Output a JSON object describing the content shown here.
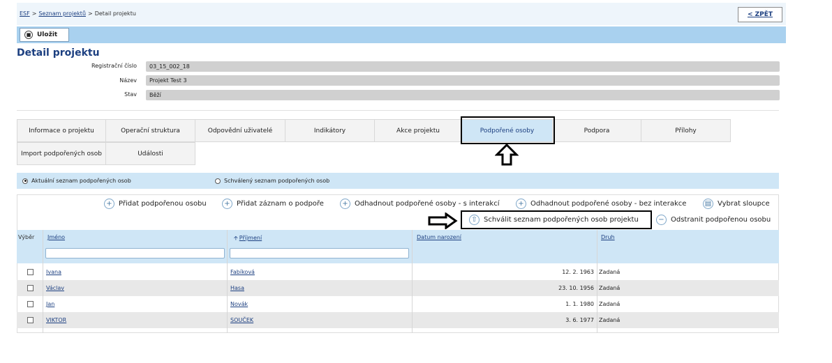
{
  "breadcrumb": [
    "ESF",
    "Seznam projektů",
    "Detail projektu"
  ],
  "back_label": "< ZPĚT",
  "save_label": "Uložit",
  "page_title": "Detail projektu",
  "fields": [
    {
      "label": "Registrační číslo",
      "value": "03_15_002_18"
    },
    {
      "label": "Název",
      "value": "Projekt Test 3"
    },
    {
      "label": "Stav",
      "value": "Běží"
    }
  ],
  "tabs": [
    "Informace o projektu",
    "Operační struktura",
    "Odpovědní uživatelé",
    "Indikátory",
    "Akce projektu",
    "Podpořené osoby",
    "Podpora",
    "Přílohy",
    "Import podpořených osob",
    "Události"
  ],
  "active_tab": "Podpořené osoby",
  "radios": [
    {
      "label": "Aktuální seznam podpořených osob",
      "checked": true
    },
    {
      "label": "Schválený seznam podpořených osob",
      "checked": false
    }
  ],
  "actions": [
    "Přidat podpořenou osobu",
    "Přidat záznam o podpoře",
    "Odhadnout podpořené osoby - s interakcí",
    "Odhadnout podpořené osoby - bez interakce",
    "Vybrat sloupce",
    "Schválit seznam podpořených osob projektu",
    "Odstranit podpořenou osobu"
  ],
  "columns": {
    "select": "Výběr",
    "first": "Jméno",
    "last": "Příjmení",
    "dob": "Datum narození",
    "kind": "Druh"
  },
  "rows": [
    {
      "first": "Ivana",
      "last": "Fabíková",
      "dob": "12. 2. 1963",
      "kind": "Zadaná"
    },
    {
      "first": "Václav",
      "last": "Hasa",
      "dob": "23. 10. 1956",
      "kind": "Zadaná"
    },
    {
      "first": "Jan",
      "last": "Novák",
      "dob": "1. 1. 1980",
      "kind": "Zadaná"
    },
    {
      "first": "VIKTOR",
      "last": "SOUČEK",
      "dob": "3. 6. 1977",
      "kind": "Zadaná"
    }
  ]
}
